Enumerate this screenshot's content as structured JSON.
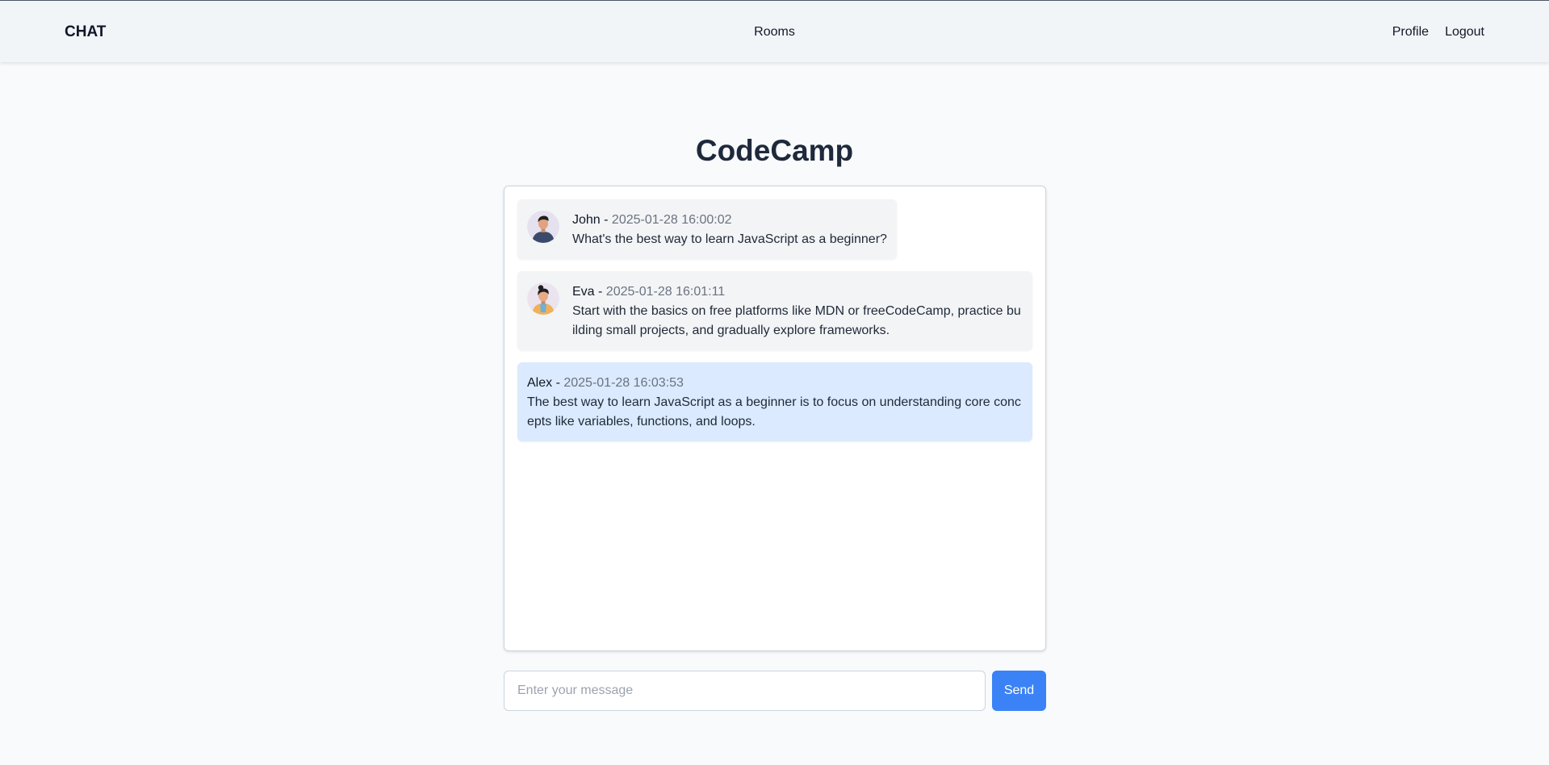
{
  "header": {
    "brand": "CHAT",
    "nav_center": "Rooms",
    "profile": "Profile",
    "logout": "Logout"
  },
  "room": {
    "title": "CodeCamp"
  },
  "messages": [
    {
      "author": "John",
      "separator": " - ",
      "timestamp": "2025-01-28 16:00:02",
      "text": "What's the best way to learn JavaScript as a beginner?",
      "avatar": "male-avatar-icon"
    },
    {
      "author": "Eva",
      "separator": " - ",
      "timestamp": "2025-01-28 16:01:11",
      "text": "Start with the basics on free platforms like MDN or freeCodeCamp, practice building small projects, and gradually explore frameworks.",
      "avatar": "female-avatar-icon"
    },
    {
      "author": "Alex",
      "separator": " - ",
      "timestamp": "2025-01-28 16:03:53",
      "text": "The best way to learn JavaScript as a beginner is to focus on understanding core concepts like variables, functions, and loops."
    }
  ],
  "composer": {
    "placeholder": "Enter your message",
    "value": "",
    "send_label": "Send"
  },
  "colors": {
    "accent": "#3b82f6",
    "own_message_bg": "#dbeafe",
    "message_bg": "#f3f4f6",
    "timestamp": "#6b7280"
  }
}
